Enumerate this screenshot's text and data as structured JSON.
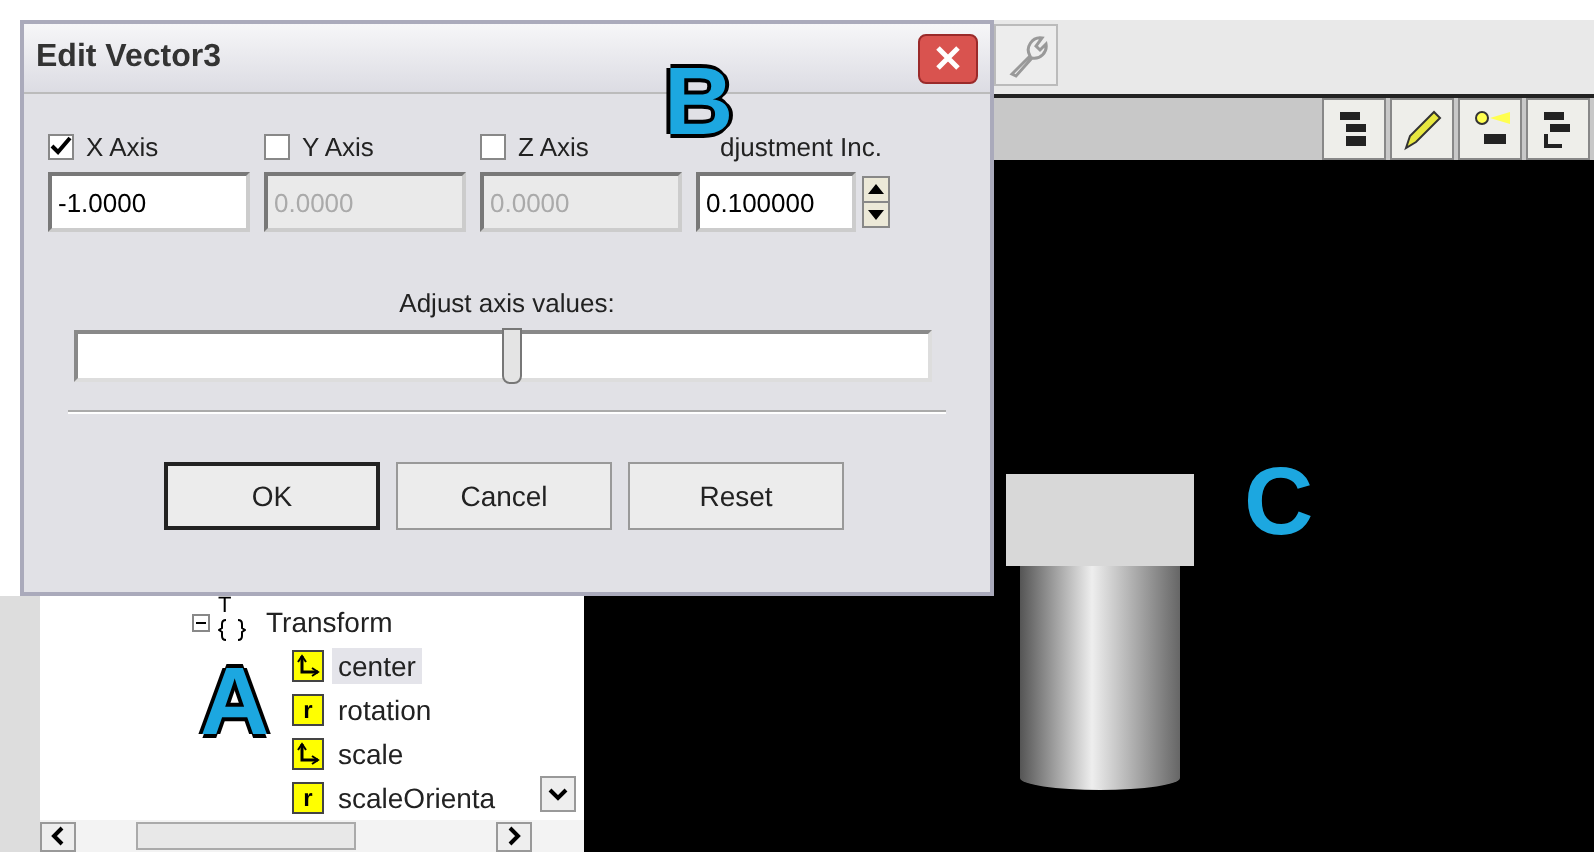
{
  "dialog": {
    "title": "Edit Vector3",
    "axes": [
      {
        "label": "X Axis",
        "checked": true,
        "value": "-1.0000"
      },
      {
        "label": "Y Axis",
        "checked": false,
        "value": "0.0000"
      },
      {
        "label": "Z Axis",
        "checked": false,
        "value": "0.0000"
      }
    ],
    "increment": {
      "label": "djustment Inc.",
      "value": "0.100000"
    },
    "slider": {
      "label": "Adjust axis values:",
      "level": 0.51
    },
    "buttons": [
      {
        "label": "OK",
        "default": true
      },
      {
        "label": "Cancel",
        "default": false
      },
      {
        "label": "Reset",
        "default": false
      }
    ]
  },
  "tree": {
    "label": "Transform",
    "badge": "T",
    "expanded": true,
    "children": [
      {
        "label": "center",
        "kind": "vector",
        "selected": true
      },
      {
        "label": "rotation",
        "kind": "rotation",
        "badge": "r",
        "selected": false
      },
      {
        "label": "scale",
        "kind": "vector",
        "selected": false
      },
      {
        "label": "scaleOrienta",
        "kind": "rotation",
        "badge": "r",
        "selected": false
      }
    ]
  },
  "annotations": [
    {
      "label": "A"
    },
    {
      "label": "B"
    },
    {
      "label": "C"
    }
  ]
}
